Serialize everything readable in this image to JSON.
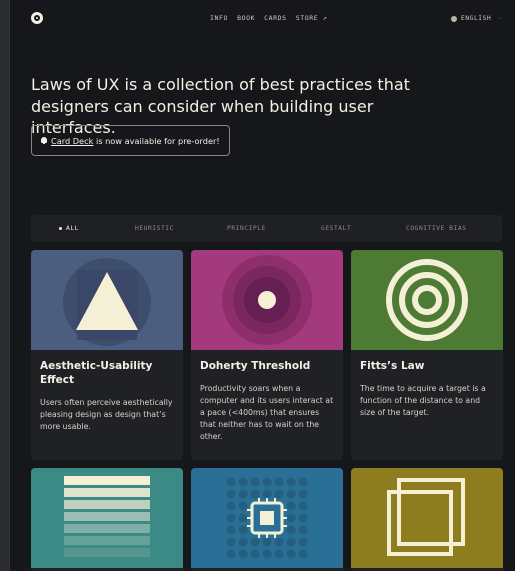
{
  "nav": {
    "items": [
      "INFO",
      "BOOK",
      "CARDS",
      "STORE ↗"
    ],
    "language": "ENGLISH"
  },
  "hero": {
    "headline": "Laws of UX is a collection of best practices that designers can consider when building user interfaces."
  },
  "notice": {
    "link_text": "Card Deck",
    "rest_text": " is now available for pre-order!"
  },
  "filters": {
    "items": [
      "ALL",
      "HEURISTIC",
      "PRINCIPLE",
      "GESTALT",
      "COGNITIVE BIAS"
    ],
    "active": "ALL"
  },
  "cards": [
    {
      "title": "Aesthetic-Usability Effect",
      "desc": "Users often perceive aesthetically pleasing design as design that’s more usable.",
      "color": "#4b5e80"
    },
    {
      "title": "Doherty Threshold",
      "desc": "Productivity soars when a computer and its users interact at a pace (<400ms) that ensures that neither has to wait on the other.",
      "color": "#a23a7d"
    },
    {
      "title": "Fitts’s Law",
      "desc": "The time to acquire a target is a function of the distance to and size of the target.",
      "color": "#4e7b34"
    },
    {
      "title": "",
      "desc": "",
      "color": "#3b8a85"
    },
    {
      "title": "",
      "desc": "",
      "color": "#2a6f95"
    },
    {
      "title": "",
      "desc": "",
      "color": "#8d7d1f"
    }
  ],
  "colors": {
    "background": "#16171a",
    "card": "#202125",
    "cream": "#f3f0e6"
  },
  "icons": [
    "logo-icon",
    "globe-icon",
    "bell-icon",
    "triangle-art-icon",
    "target-dot-art-icon",
    "concentric-rings-art-icon",
    "stacked-bars-art-icon",
    "chip-grid-art-icon",
    "overlapping-squares-art-icon"
  ]
}
